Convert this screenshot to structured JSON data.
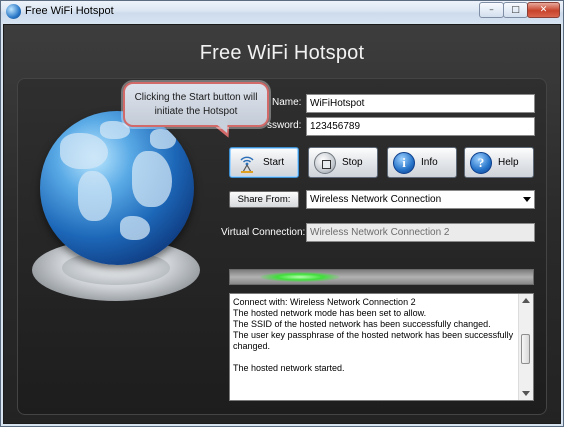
{
  "window": {
    "title": "Free WiFi Hotspot",
    "icon": "globe-icon"
  },
  "caption_buttons": {
    "minimize": "–",
    "maximize": "□",
    "close": "✕"
  },
  "app": {
    "heading": "Free WiFi Hotspot"
  },
  "form": {
    "name_label": "Name:",
    "name_value": "WiFiHotspot",
    "password_label": "ssword:",
    "password_value": "123456789",
    "share_from_label": "Share From:",
    "share_from_value": "Wireless Network Connection",
    "virtual_connection_label": "Virtual Connection:",
    "virtual_connection_value": "Wireless Network Connection 2"
  },
  "buttons": {
    "start": {
      "label": "Start",
      "icon": "wifi-antenna-icon"
    },
    "stop": {
      "label": "Stop",
      "icon": "stop-icon"
    },
    "info": {
      "label": "Info",
      "icon": "info-icon",
      "glyph": "i"
    },
    "help": {
      "label": "Help",
      "icon": "help-icon",
      "glyph": "?"
    }
  },
  "tooltip": {
    "text": "Clicking the Start button will initiate the Hotspot"
  },
  "log": {
    "lines": [
      " Connect with: Wireless Network Connection 2",
      "The hosted network mode has been set to allow.",
      "The SSID of the hosted network has been successfully changed.",
      "The user key passphrase of the hosted network has been successfully changed.",
      "",
      "The hosted network started."
    ]
  },
  "colors": {
    "accent": "#3fe03a",
    "tooltip_border": "#d36a6a",
    "panel_bg": "#2a2a2a"
  }
}
